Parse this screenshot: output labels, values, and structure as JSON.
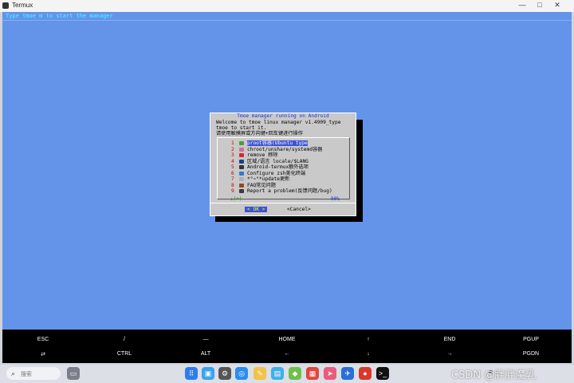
{
  "window": {
    "title": "Termux",
    "controls": {
      "minimize": "—",
      "maximize": "□",
      "close": "✕"
    }
  },
  "terminal": {
    "top_line": "Type tmoe m to start the manager"
  },
  "dialog": {
    "title": "Tmoe manager running on Android",
    "text_lines": [
      "Welcome to tmoe linux manager v1.4909_type",
      "tmoe to start it.",
      "请使用触摸屏或方向键+回车键进行操作"
    ],
    "menu_items": [
      {
        "num": "1",
        "label": "proot容器(Ubuntu type",
        "icon_color": "#4a9f3a",
        "selected": true
      },
      {
        "num": "2",
        "label": "chroot/unshare/systemd容器",
        "icon_color": "#d86aa0",
        "selected": false
      },
      {
        "num": "3",
        "label": "remove 移除",
        "icon_color": "#d22a2a",
        "selected": false
      },
      {
        "num": "4",
        "label": "区域/语言 locale/$LANG",
        "icon_color": "#1c3f8a",
        "selected": false
      },
      {
        "num": "5",
        "label": "Android-termux额外选项",
        "icon_color": "#333333",
        "selected": false
      },
      {
        "num": "6",
        "label": "Configure zsh美化终端",
        "icon_color": "#2d7bd4",
        "selected": false
      },
      {
        "num": "7",
        "label": "*°∘°*update更新",
        "icon_color": "#b0b0b0",
        "selected": false
      },
      {
        "num": "8",
        "label": "FAQ常见问题",
        "icon_color": "#8a4b2a",
        "selected": false
      },
      {
        "num": "9",
        "label": "Report a problem(反馈问题/bug)",
        "icon_color": "#3a3a3a",
        "selected": false
      }
    ],
    "scroll_indicator": "↓(+)",
    "percent": "90%",
    "ok_label": "OK",
    "ok_left": "<",
    "ok_right": ">",
    "cancel_label": "<Cancel>"
  },
  "extra_keys": {
    "row1": [
      "ESC",
      "/",
      "—",
      "HOME",
      "↑",
      "END",
      "PGUP"
    ],
    "row2": [
      "⇄",
      "CTRL",
      "ALT",
      "←",
      "↓",
      "→",
      "PGDN"
    ]
  },
  "taskbar": {
    "search_placeholder": "搜索",
    "tray_text": "⊕  ⌂"
  },
  "watermark": "CSDN @胖胖魔乳"
}
